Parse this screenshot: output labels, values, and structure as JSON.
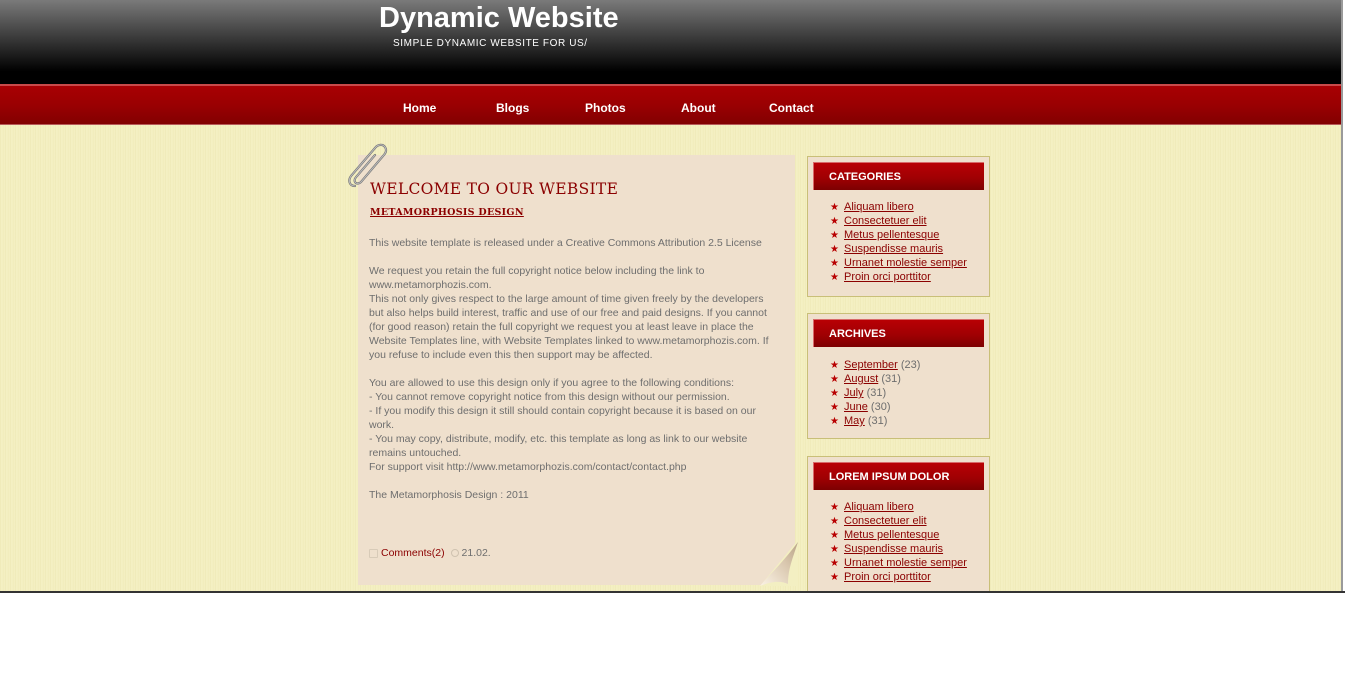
{
  "header": {
    "site_title": "Dynamic Website",
    "tagline": "SIMPLE DYNAMIC WEBSITE FOR US/"
  },
  "nav": {
    "items": [
      {
        "label": "Home"
      },
      {
        "label": "Blogs"
      },
      {
        "label": "Photos"
      },
      {
        "label": "About"
      },
      {
        "label": "Contact"
      }
    ]
  },
  "post": {
    "title": "WELCOME TO OUR WEBSITE",
    "subtitle": "METAMORPHOSIS DESIGN",
    "paragraphs": [
      "This website template is released under a Creative Commons Attribution 2.5 License",
      "We request you retain the full copyright notice below including the link to www.metamorphozis.com.\nThis not only gives respect to the large amount of time given freely by the developers but also helps build interest, traffic and use of our free and paid designs. If you cannot (for good reason) retain the full copyright we request you at least leave in place the Website Templates line, with Website Templates linked to www.metamorphozis.com. If you refuse to include even this then support may be affected.",
      "You are allowed to use this design only if you agree to the following conditions:\n- You cannot remove copyright notice from this design without our permission.\n- If you modify this design it still should contain copyright because it is based on our work.\n- You may copy, distribute, modify, etc. this template as long as link to our website remains untouched.\nFor support visit http://www.metamorphozis.com/contact/contact.php",
      "The Metamorphosis Design : 2011"
    ],
    "comments_label": "Comments(2)",
    "date": "21.02."
  },
  "sidebar": {
    "categories": {
      "title": "CATEGORIES",
      "items": [
        {
          "label": "Aliquam libero"
        },
        {
          "label": "Consectetuer elit"
        },
        {
          "label": "Metus pellentesque"
        },
        {
          "label": "Suspendisse mauris"
        },
        {
          "label": "Urnanet molestie semper"
        },
        {
          "label": "Proin orci porttitor"
        }
      ]
    },
    "archives": {
      "title": "ARCHIVES",
      "items": [
        {
          "label": "September",
          "count": "(23)"
        },
        {
          "label": "August",
          "count": "(31)"
        },
        {
          "label": "July",
          "count": "(31)"
        },
        {
          "label": "June",
          "count": "(30)"
        },
        {
          "label": "May",
          "count": "(31)"
        }
      ]
    },
    "lorem": {
      "title": "LOREM IPSUM DOLOR",
      "items": [
        {
          "label": "Aliquam libero"
        },
        {
          "label": "Consectetuer elit"
        },
        {
          "label": "Metus pellentesque"
        },
        {
          "label": "Suspendisse mauris"
        },
        {
          "label": "Urnanet molestie semper"
        },
        {
          "label": "Proin orci porttitor"
        }
      ]
    }
  },
  "icons": {
    "bullet": "★"
  },
  "colors": {
    "accent_red": "#8b0000",
    "nav_red": "#9a0002",
    "paper": "#efe0cd",
    "background": "#f3efc2"
  }
}
